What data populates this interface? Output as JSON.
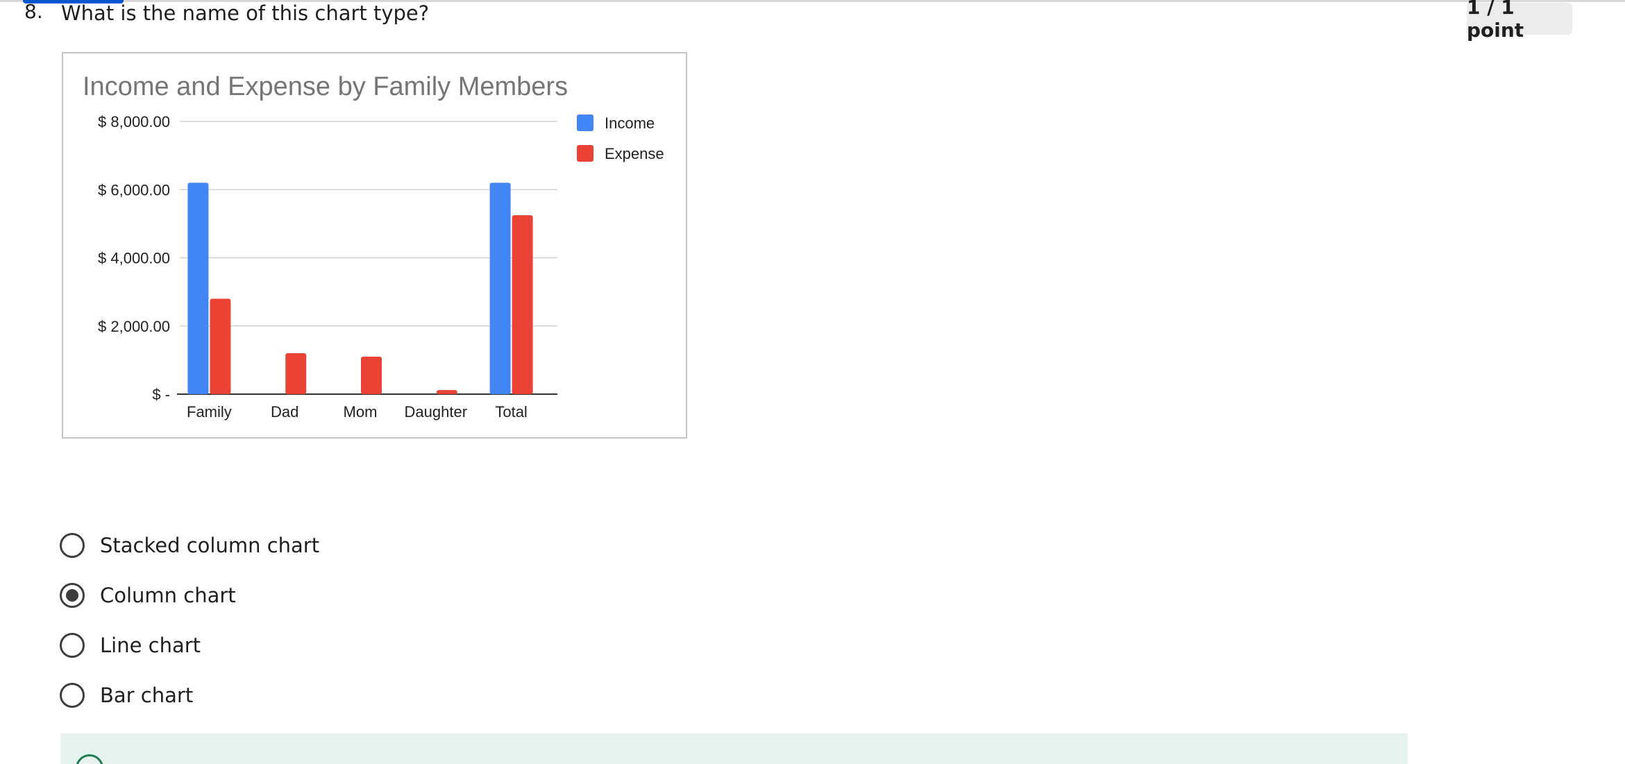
{
  "question": {
    "number": "8.",
    "text": "What is the name of this chart type?",
    "score": "1 / 1 point"
  },
  "options": [
    {
      "label": "Stacked column chart",
      "selected": false
    },
    {
      "label": "Column chart",
      "selected": true
    },
    {
      "label": "Line chart",
      "selected": false
    },
    {
      "label": "Bar chart",
      "selected": false
    }
  ],
  "colors": {
    "income": "#4285f4",
    "expense": "#ea4335",
    "feedback_bg": "#e6f2ee",
    "accent": "#0056d2"
  },
  "chart_data": {
    "type": "bar",
    "title": "Income and Expense by Family Members",
    "categories": [
      "Family",
      "Dad",
      "Mom",
      "Daughter",
      "Total"
    ],
    "series": [
      {
        "name": "Income",
        "values": [
          6200,
          0,
          0,
          0,
          6200
        ]
      },
      {
        "name": "Expense",
        "values": [
          2800,
          1200,
          1100,
          120,
          5250
        ]
      }
    ],
    "ylim": [
      0,
      8000
    ],
    "yticks": [
      0,
      2000,
      4000,
      6000,
      8000
    ],
    "ytick_labels": [
      "$ -",
      "$ 2,000.00",
      "$ 4,000.00",
      "$ 6,000.00",
      "$ 8,000.00"
    ],
    "xlabel": "",
    "ylabel": "",
    "grid": true,
    "legend": "right"
  }
}
